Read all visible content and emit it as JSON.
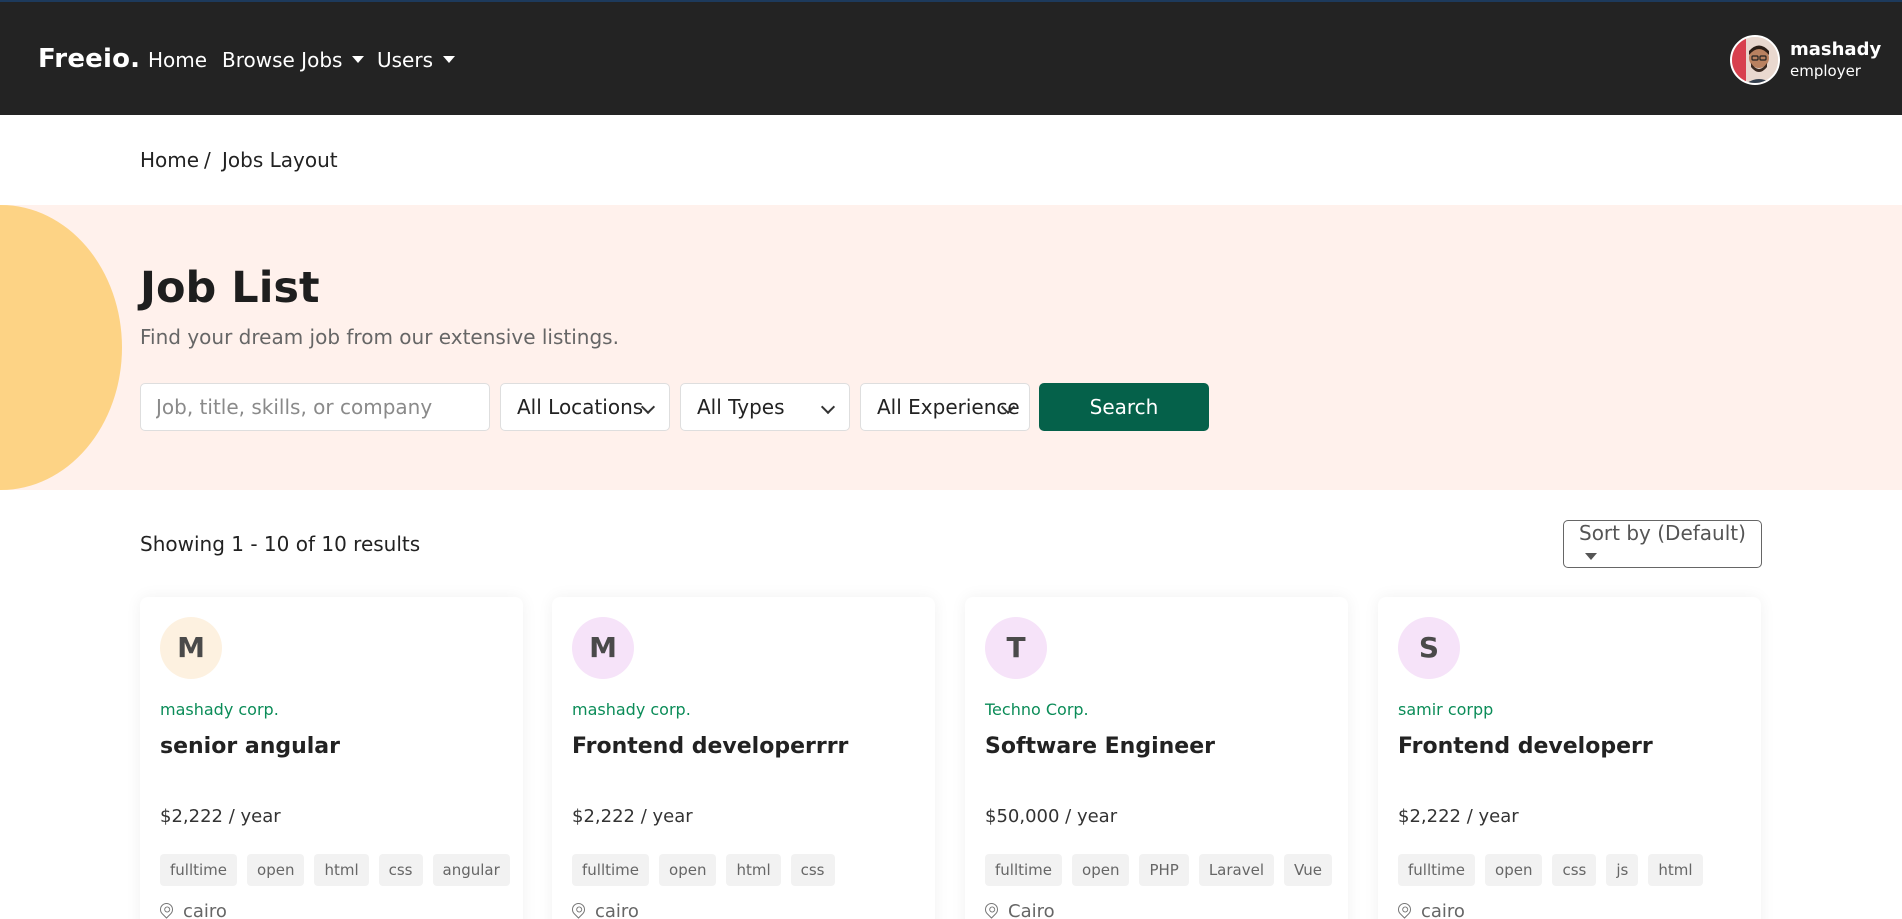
{
  "navbar": {
    "brand": "Freeio.",
    "links": [
      {
        "label": "Home"
      },
      {
        "label": "Browse Jobs"
      },
      {
        "label": "Users"
      }
    ],
    "user": {
      "name": "mashady",
      "role": "employer"
    }
  },
  "breadcrumb": {
    "home": "Home",
    "separator": "/",
    "current": "Jobs Layout"
  },
  "hero": {
    "title": "Job List",
    "subtitle": "Find your dream job from our extensive listings.",
    "search_placeholder": "Job, title, skills, or company",
    "location_select": "All Locations",
    "type_select": "All Types",
    "experience_select": "All Experience",
    "search_button": "Search"
  },
  "results": {
    "summary": "Showing 1 - 10 of 10 results",
    "sort_label": "Sort by (Default)"
  },
  "jobs": [
    {
      "initial": "M",
      "logo_bg": "#fdf1e0",
      "company": "mashady corp.",
      "title": "senior angular",
      "salary": "$2,222 / year",
      "tags": [
        "fulltime",
        "open",
        "html",
        "css",
        "angular"
      ],
      "location": "cairo"
    },
    {
      "initial": "M",
      "logo_bg": "#f6e3f9",
      "company": "mashady corp.",
      "title": "Frontend developerrrr",
      "salary": "$2,222 / year",
      "tags": [
        "fulltime",
        "open",
        "html",
        "css"
      ],
      "location": "cairo"
    },
    {
      "initial": "T",
      "logo_bg": "#f6e3f9",
      "company": "Techno Corp.",
      "title": "Software Engineer",
      "salary": "$50,000 / year",
      "tags": [
        "fulltime",
        "open",
        "PHP",
        "Laravel",
        "Vue"
      ],
      "location": "Cairo"
    },
    {
      "initial": "S",
      "logo_bg": "#f6e3f9",
      "company": "samir corpp",
      "title": "Frontend developerr",
      "salary": "$2,222 / year",
      "tags": [
        "fulltime",
        "open",
        "css",
        "js",
        "html"
      ],
      "location": "cairo"
    }
  ],
  "colors": {
    "navbar": "#232323",
    "hero_bg": "#fff1ec",
    "hero_blob": "#fdd385",
    "primary_button": "#05614a",
    "company_text": "#0b8c58"
  }
}
